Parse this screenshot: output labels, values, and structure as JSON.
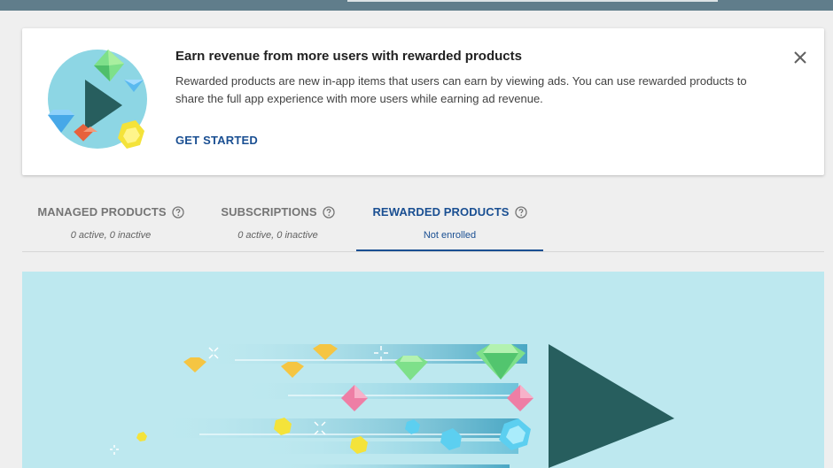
{
  "banner": {
    "title": "Earn revenue from more users with rewarded products",
    "description": "Rewarded products are new in-app items that users can earn by viewing ads. You can use rewarded products to share the full app experience with more users while earning ad revenue.",
    "cta_label": "GET STARTED"
  },
  "tabs": [
    {
      "label": "MANAGED PRODUCTS",
      "sub": "0 active, 0 inactive",
      "active": false
    },
    {
      "label": "SUBSCRIPTIONS",
      "sub": "0 active, 0 inactive",
      "active": false
    },
    {
      "label": "REWARDED PRODUCTS",
      "sub": "Not enrolled",
      "active": true
    }
  ],
  "colors": {
    "accent": "#1a4f92",
    "hero_background": "#bde8ef",
    "play_triangle": "#275e5e"
  },
  "icons": {
    "close": "close-icon",
    "help": "help-circle-icon"
  }
}
